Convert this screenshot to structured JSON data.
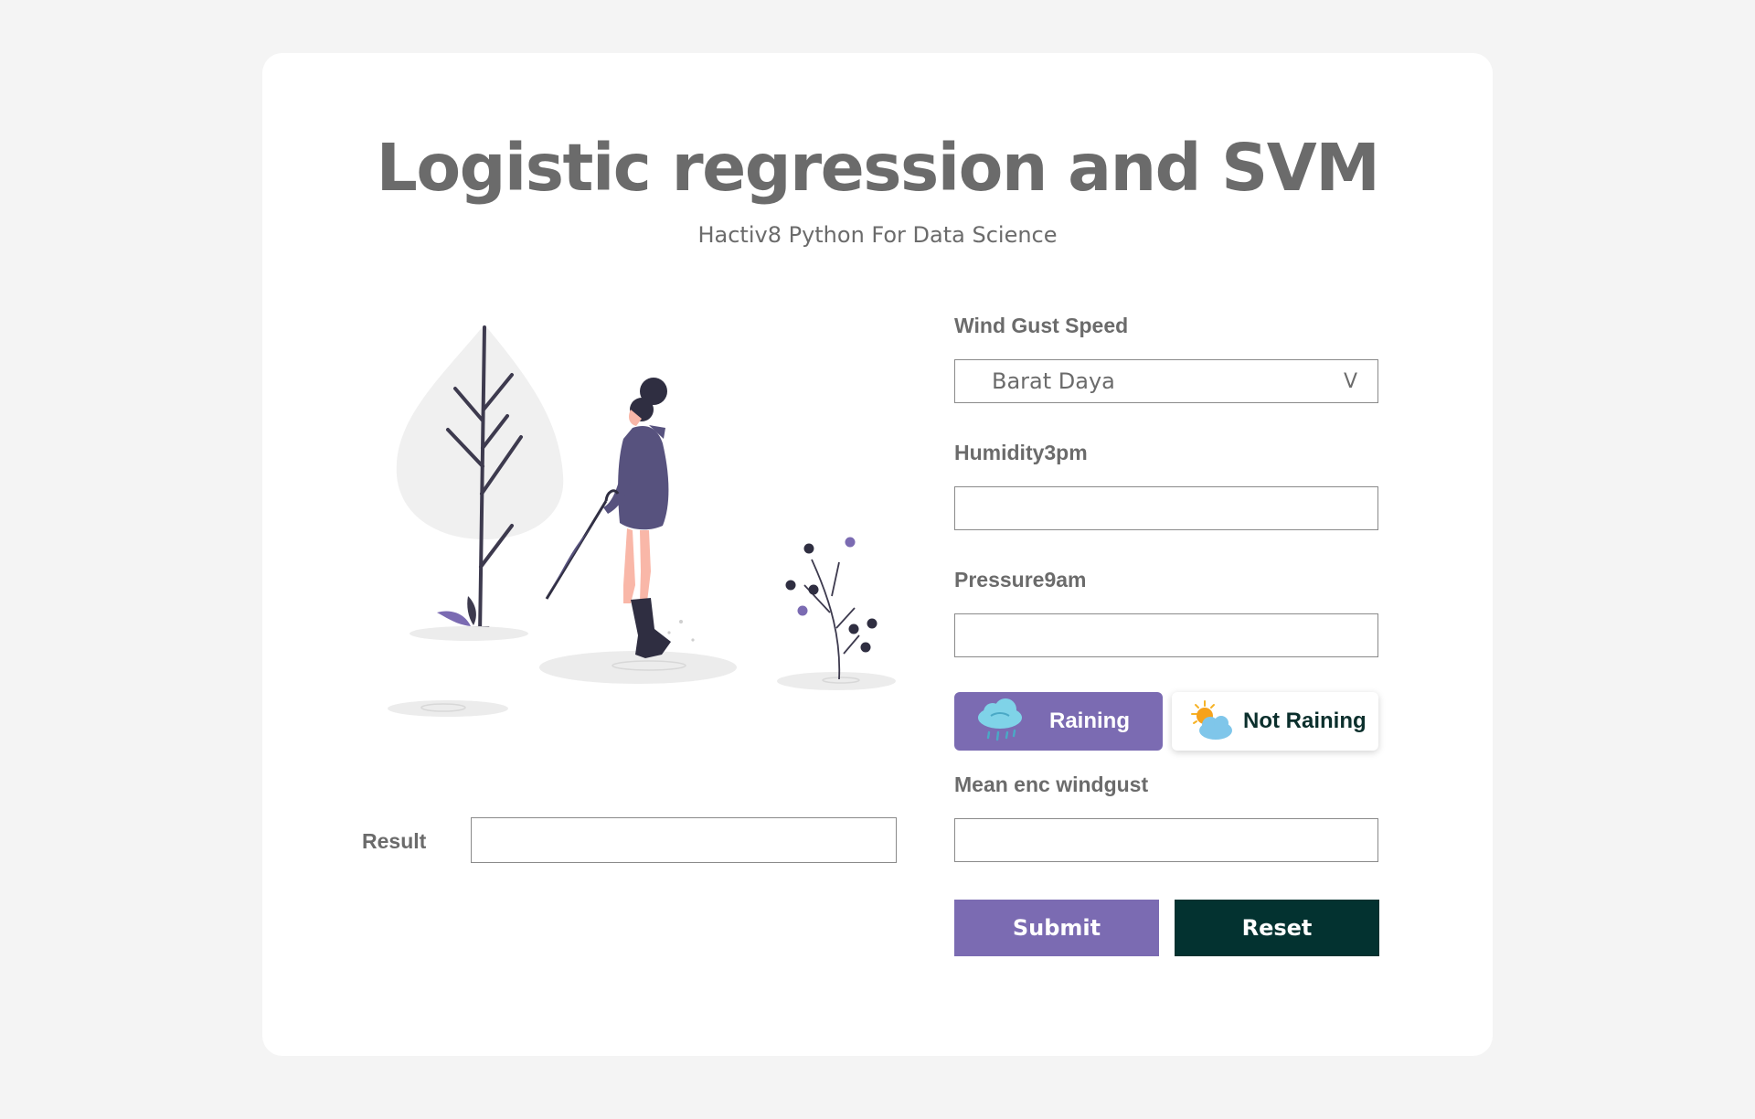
{
  "header": {
    "title": "Logistic regression and SVM",
    "subtitle": "Hactiv8 Python For Data Science"
  },
  "form": {
    "wind_gust_speed": {
      "label": "Wind Gust Speed",
      "selected": "Barat Daya",
      "chevron": "V"
    },
    "humidity3pm": {
      "label": "Humidity3pm",
      "value": ""
    },
    "pressure9am": {
      "label": "Pressure9am",
      "value": ""
    },
    "rain_toggle": {
      "raining_label": "Raining",
      "raining_icon": "rain-cloud-icon",
      "not_raining_label": "Not Raining",
      "not_raining_icon": "sun-cloud-icon",
      "selected": "Raining"
    },
    "mean_enc_windgust": {
      "label": "Mean enc windgust",
      "value": ""
    },
    "submit_label": "Submit",
    "reset_label": "Reset"
  },
  "result": {
    "label": "Result",
    "value": ""
  },
  "colors": {
    "accent": "#7b6bb2",
    "dark": "#033230",
    "text": "#6b6b6b",
    "background": "#f4f4f4"
  }
}
